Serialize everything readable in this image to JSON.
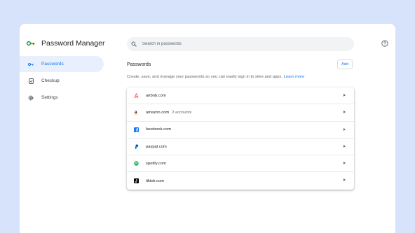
{
  "app": {
    "title": "Password Manager"
  },
  "sidebar": {
    "items": [
      {
        "label": "Passwords",
        "icon": "key-icon",
        "active": true
      },
      {
        "label": "Checkup",
        "icon": "shield-check-icon",
        "active": false
      },
      {
        "label": "Settings",
        "icon": "gear-icon",
        "active": false
      }
    ]
  },
  "search": {
    "placeholder": "Search in passwords",
    "value": ""
  },
  "main": {
    "section_title": "Passwords",
    "add_label": "Add",
    "description": "Create, save, and manage your passwords so you can easily sign in to sites and apps.",
    "learn_more": "Learn more",
    "sites": [
      {
        "name": "airbnb.com",
        "extra": "",
        "icon": "airbnb-icon",
        "color": "#ff5a5f"
      },
      {
        "name": "amazon.com",
        "extra": "2 accounts",
        "icon": "amazon-icon",
        "color": "#000000"
      },
      {
        "name": "facebook.com",
        "extra": "",
        "icon": "facebook-icon",
        "color": "#1877f2"
      },
      {
        "name": "paypal.com",
        "extra": "",
        "icon": "paypal-icon",
        "color": "#003087"
      },
      {
        "name": "spotify.com",
        "extra": "",
        "icon": "spotify-icon",
        "color": "#1db954"
      },
      {
        "name": "tiktok.com",
        "extra": "",
        "icon": "tiktok-icon",
        "color": "#000000"
      }
    ]
  },
  "colors": {
    "accent": "#1a73e8",
    "background": "#d6e3fb",
    "active_nav": "#e8f0fe"
  }
}
